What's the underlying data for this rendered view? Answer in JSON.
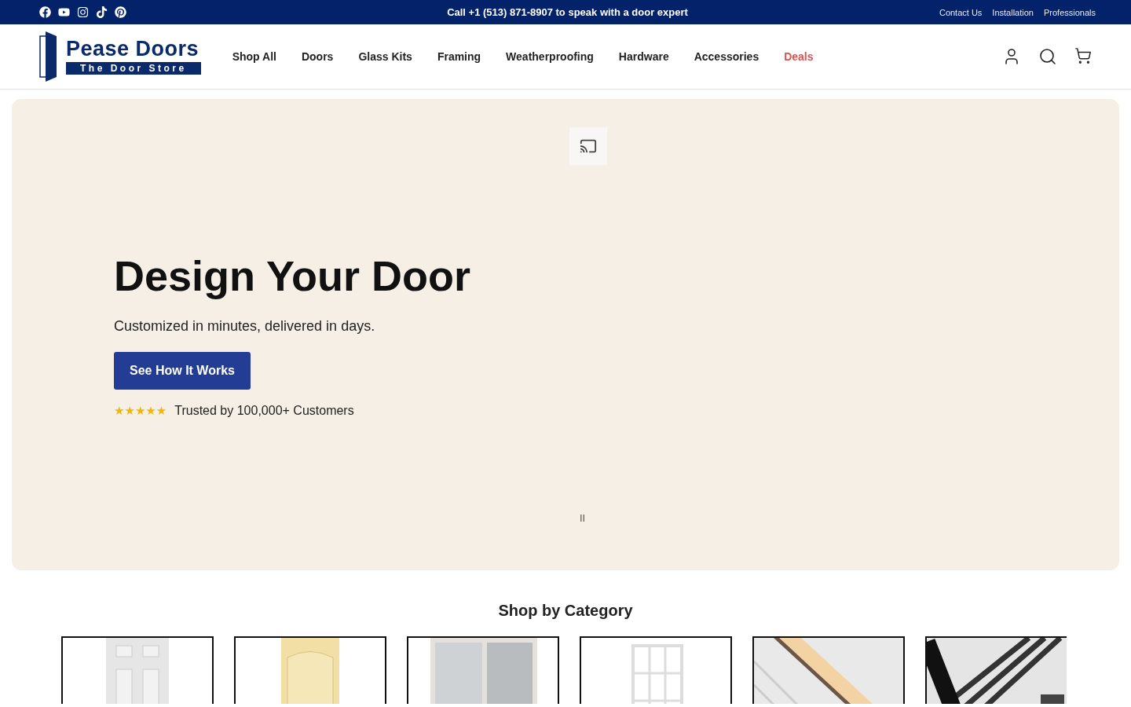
{
  "top_bar": {
    "announcement": "Call +1 (513) 871-8907 to speak with a door expert",
    "links": [
      "Contact Us",
      "Installation",
      "Professionals"
    ]
  },
  "header": {
    "logo": {
      "name": "Pease Doors",
      "tagline": "The Door Store"
    },
    "nav": [
      {
        "label": "Shop All",
        "kind": "link"
      },
      {
        "label": "Doors",
        "kind": "link"
      },
      {
        "label": "Glass Kits",
        "kind": "link"
      },
      {
        "label": "Framing",
        "kind": "link"
      },
      {
        "label": "Weatherproofing",
        "kind": "link"
      },
      {
        "label": "Hardware",
        "kind": "link"
      },
      {
        "label": "Accessories",
        "kind": "link"
      },
      {
        "label": "Deals",
        "kind": "deal"
      }
    ]
  },
  "hero": {
    "title": "Design Your Door",
    "subtitle": "Customized in minutes, delivered in days.",
    "button": "See How It Works",
    "stars": 5,
    "trust": "Trusted by 100,000+ Customers",
    "pause": "II"
  },
  "categories": {
    "title": "Shop by Category"
  }
}
